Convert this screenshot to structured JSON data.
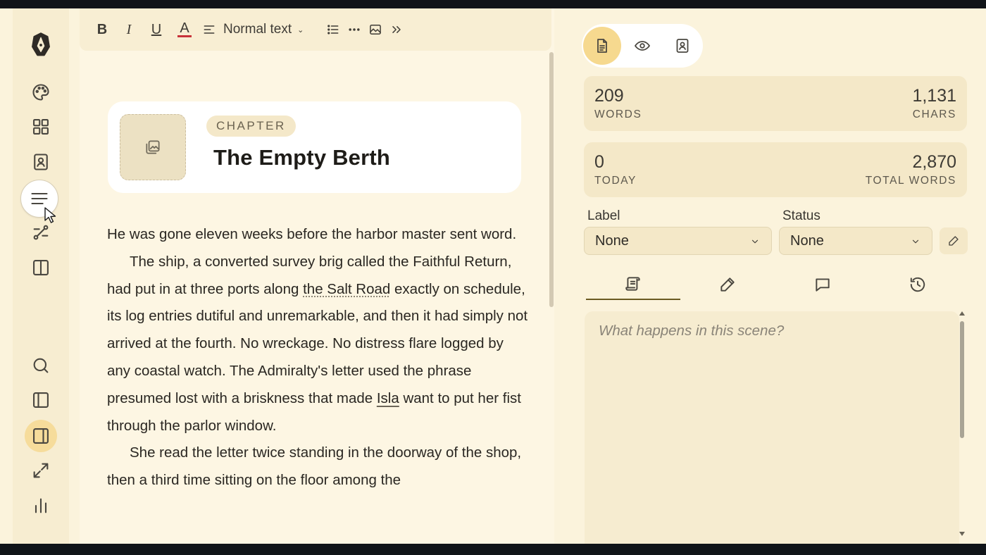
{
  "toolbar": {
    "bold_label": "B",
    "italic_label": "I",
    "underline_label": "U",
    "color_label": "A",
    "text_color": "#c8323a",
    "style_value": "Normal text"
  },
  "chapter": {
    "badge": "CHAPTER",
    "title": "The Empty Berth"
  },
  "body": {
    "p1": "He was gone eleven weeks before the harbor master sent word.",
    "p2_a": "The ship, a converted survey brig called the Faithful Return, had put in at three ports along ",
    "p2_link": "the Salt Road",
    "p2_b": " exactly on schedule, its log entries dutiful and unremarkable, and then it had simply not arrived at the fourth. No wreckage. No distress flare logged by any coastal watch. The Admiralty's letter used the phrase presumed lost with a briskness that made ",
    "p2_name": "Isla",
    "p2_c": " want to put her fist through the parlor window.",
    "p3": "She read the letter twice standing in the doorway of the shop, then a third time sitting on the floor among the"
  },
  "stats": {
    "words_value": "209",
    "words_label": "WORDS",
    "chars_value": "1,131",
    "chars_label": "CHARS",
    "today_value": "0",
    "today_label": "TODAY",
    "total_value": "2,870",
    "total_label": "TOTAL WORDS"
  },
  "meta": {
    "label_title": "Label",
    "label_value": "None",
    "status_title": "Status",
    "status_value": "None"
  },
  "notes": {
    "placeholder": "What happens in this scene?"
  },
  "colors": {
    "accent": "#f6d98f",
    "background": "#fbf3dc",
    "card": "#f4e8c8"
  }
}
